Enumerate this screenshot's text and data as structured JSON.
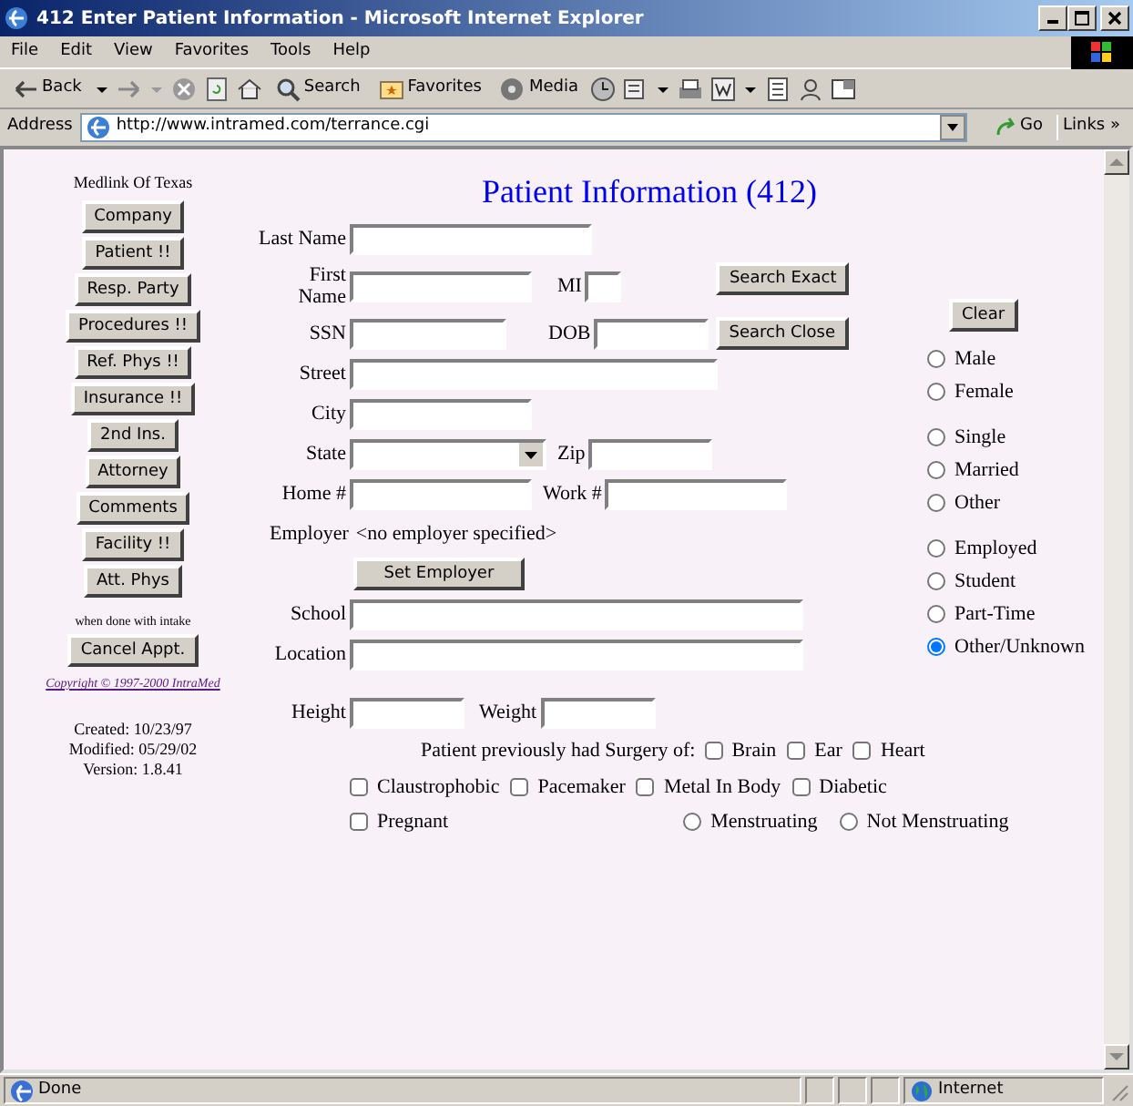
{
  "window": {
    "title": "412 Enter Patient Information - Microsoft Internet Explorer"
  },
  "menu": [
    "File",
    "Edit",
    "View",
    "Favorites",
    "Tools",
    "Help"
  ],
  "toolbar": {
    "back": "Back",
    "search": "Search",
    "favorites": "Favorites",
    "media": "Media"
  },
  "address_bar": {
    "label": "Address",
    "url": "http://www.intramed.com/terrance.cgi",
    "go": "Go",
    "links": "Links",
    "more": "»"
  },
  "sidebar": {
    "org": "Medlink Of Texas",
    "buttons": [
      "Company",
      "Patient !!",
      "Resp. Party",
      "Procedures !!",
      "Ref. Phys !!",
      "Insurance !!",
      "2nd Ins.",
      "Attorney",
      "Comments",
      "Facility !!",
      "Att. Phys"
    ],
    "note": "when done with intake",
    "cancel": "Cancel Appt.",
    "copyright": "Copyright © 1997-2000 IntraMed",
    "created": "Created: 10/23/97",
    "modified": "Modified: 05/29/02",
    "version": "Version: 1.8.41"
  },
  "form": {
    "heading": "Patient Information (412)",
    "last_name": "Last Name",
    "first_name": "First Name",
    "mi": "MI",
    "search_exact": "Search Exact",
    "ssn": "SSN",
    "dob": "DOB",
    "search_close": "Search Close",
    "street": "Street",
    "city": "City",
    "state": "State",
    "zip": "Zip",
    "home_phone": "Home #",
    "work_phone": "Work #",
    "employer": "Employer",
    "employer_value": "<no employer specified>",
    "set_employer": "Set Employer",
    "school": "School",
    "location": "Location",
    "height": "Height",
    "weight": "Weight"
  },
  "options": {
    "clear": "Clear",
    "gender": [
      {
        "label": "Male",
        "selected": false
      },
      {
        "label": "Female",
        "selected": false
      }
    ],
    "marital": [
      {
        "label": "Single",
        "selected": false
      },
      {
        "label": "Married",
        "selected": false
      },
      {
        "label": "Other",
        "selected": false
      }
    ],
    "employment": [
      {
        "label": "Employed",
        "selected": false
      },
      {
        "label": "Student",
        "selected": false
      },
      {
        "label": "Part-Time",
        "selected": false
      },
      {
        "label": "Other/Unknown",
        "selected": true
      }
    ]
  },
  "history": {
    "surgery_label": "Patient previously had Surgery of:",
    "surgery": [
      {
        "label": "Brain",
        "checked": false
      },
      {
        "label": "Ear",
        "checked": false
      },
      {
        "label": "Heart",
        "checked": false
      }
    ],
    "conditions": [
      {
        "label": "Claustrophobic",
        "checked": false
      },
      {
        "label": "Pacemaker",
        "checked": false
      },
      {
        "label": "Metal In Body",
        "checked": false
      },
      {
        "label": "Diabetic",
        "checked": false
      }
    ],
    "pregnant": {
      "label": "Pregnant",
      "checked": false
    },
    "menstruation": [
      {
        "label": "Menstruating",
        "selected": false
      },
      {
        "label": "Not Menstruating",
        "selected": false
      }
    ]
  },
  "status_bar": {
    "text": "Done",
    "zone": "Internet"
  }
}
